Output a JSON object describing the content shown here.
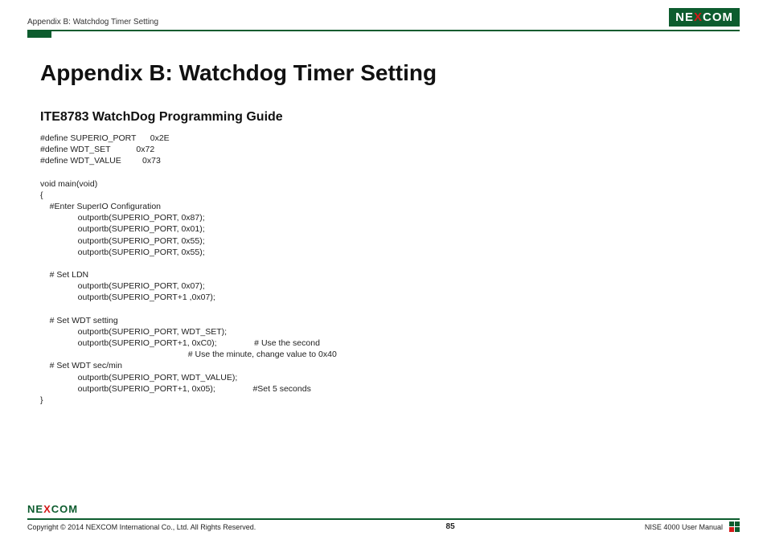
{
  "header": {
    "breadcrumb": "Appendix B: Watchdog Timer Setting",
    "brand_pre": "NE",
    "brand_x": "X",
    "brand_post": "COM"
  },
  "title": "Appendix B: Watchdog Timer Setting",
  "subtitle": "ITE8783 WatchDog Programming Guide",
  "code": "#define SUPERIO_PORT      0x2E\n#define WDT_SET           0x72\n#define WDT_VALUE         0x73\n\nvoid main(void)\n{\n    #Enter SuperIO Configuration\n                outportb(SUPERIO_PORT, 0x87);\n                outportb(SUPERIO_PORT, 0x01);\n                outportb(SUPERIO_PORT, 0x55);\n                outportb(SUPERIO_PORT, 0x55);\n\n    # Set LDN\n                outportb(SUPERIO_PORT, 0x07);\n                outportb(SUPERIO_PORT+1 ,0x07);\n\n    # Set WDT setting\n                outportb(SUPERIO_PORT, WDT_SET);\n                outportb(SUPERIO_PORT+1, 0xC0);                # Use the second\n                                                               # Use the minute, change value to 0x40\n    # Set WDT sec/min\n                outportb(SUPERIO_PORT, WDT_VALUE);\n                outportb(SUPERIO_PORT+1, 0x05);                #Set 5 seconds\n}",
  "footer": {
    "copyright": "Copyright © 2014 NEXCOM International Co., Ltd. All Rights Reserved.",
    "page": "85",
    "manual": "NISE 4000 User Manual",
    "brand_pre": "NE",
    "brand_x": "X",
    "brand_post": "COM"
  }
}
